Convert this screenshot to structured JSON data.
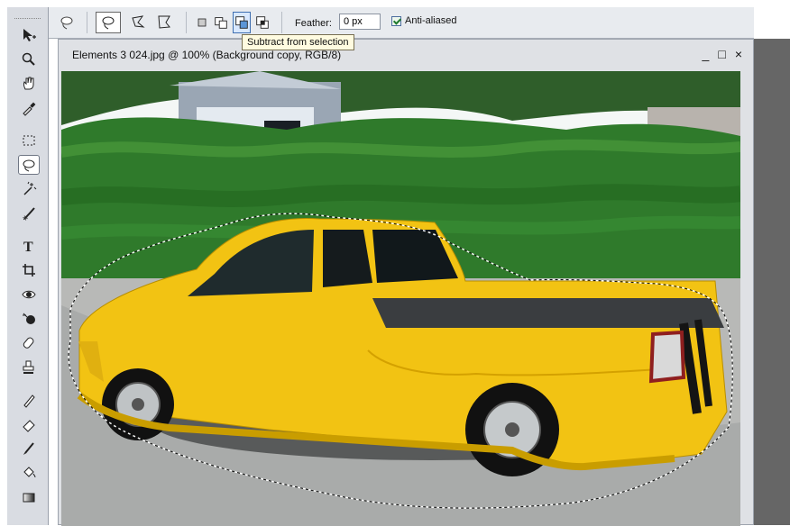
{
  "options": {
    "feather_label": "Feather:",
    "feather_value": "0 px",
    "antialiased_label": "Anti-aliased",
    "tooltip": "Subtract from selection"
  },
  "document": {
    "title": "Elements 3 024.jpg @ 100% (Background copy, RGB/8)",
    "minimize": "_",
    "maximize": "□",
    "close": "×"
  },
  "toolbox_icons": [
    "move-tool-icon",
    "zoom-tool-icon",
    "hand-tool-icon",
    "eyedropper-tool-icon",
    "marquee-tool-icon",
    "lasso-tool-icon",
    "magic-wand-tool-icon",
    "selection-brush-tool-icon",
    "text-tool-icon",
    "crop-tool-icon",
    "red-eye-tool-icon",
    "spot-healing-tool-icon",
    "clone-stamp-tool-icon",
    "pencil-tool-icon",
    "eraser-tool-icon",
    "brush-tool-icon",
    "paint-bucket-tool-icon",
    "gradient-tool-icon"
  ],
  "colors": {
    "truck": "#f2c313",
    "hedge": "#2f7a2b",
    "sky": "#f4f7f6"
  }
}
